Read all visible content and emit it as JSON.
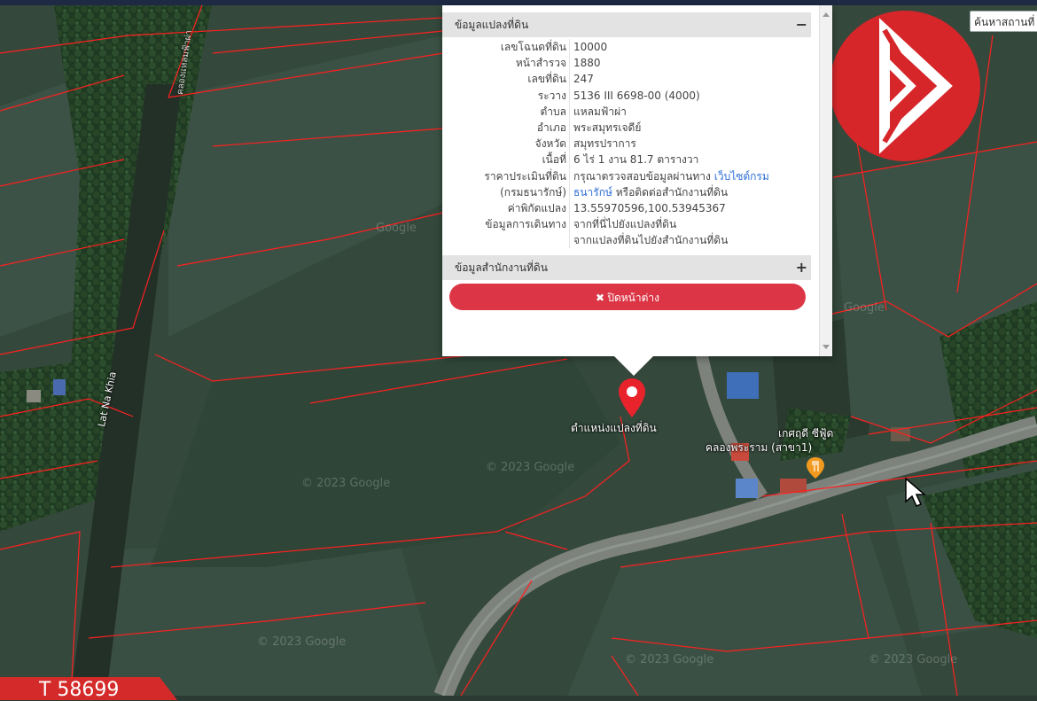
{
  "popup": {
    "section_title": "ข้อมูลแปลงที่ดิน",
    "section_toggle": "−",
    "rows": [
      {
        "key": "เลขโฉนดที่ดิน",
        "value": "10000"
      },
      {
        "key": "หน้าสำรวจ",
        "value": "1880"
      },
      {
        "key": "เลขที่ดิน",
        "value": "247"
      },
      {
        "key": "ระวาง",
        "value": "5136 III 6698-00 (4000)"
      },
      {
        "key": "ตำบล",
        "value": "แหลมฟ้าผ่า"
      },
      {
        "key": "อำเภอ",
        "value": "พระสมุทรเจดีย์"
      },
      {
        "key": "จังหวัด",
        "value": "สมุทรปราการ"
      },
      {
        "key": "เนื้อที่",
        "value": "6 ไร่ 1 งาน 81.7 ตารางวา"
      }
    ],
    "price_key_1": "ราคาประเมินที่ดิน",
    "price_key_2": "(กรมธนารักษ์)",
    "price_text_1": "กรุณาตรวจสอบข้อมูลผ่านทาง",
    "price_link_1": "เว็บไซต์กรม",
    "price_link_2": "ธนารักษ์",
    "price_text_2": "หรือติดต่อสำนักงานที่ดิน",
    "coord_key": "ค่าพิกัดแปลง",
    "coord_value": "13.55970596,100.53945367",
    "travel_key": "ข้อมูลการเดินทาง",
    "travel_link_1": "จากที่นี่ไปยังแปลงที่ดิน",
    "travel_link_2": "จากแปลงที่ดินไปยังสำนักงานที่ดิน",
    "office_title": "ข้อมูลสำนักงานที่ดิน",
    "office_toggle": "+",
    "close_label": "✖ ปิดหน้าต่าง"
  },
  "search": {
    "placeholder": "ค้นหาสถานที่"
  },
  "map": {
    "pin_label": "ตำแหน่งแปลงที่ดิน",
    "poi_line1": "เกศฤดี ซีฟู้ด",
    "poi_line2": "คลองพระราม (สาขา1)",
    "road_label_1": "Lat Na Khia",
    "road_label_2": "คลองแหลมฟ้าผ่า",
    "watermark": "© 2023 Google",
    "google": "Google",
    "pin_color": "#e8232b",
    "parcel_line_color": "#ff2020"
  },
  "badge": {
    "text": "T 58699",
    "color": "#d42a2a"
  },
  "logo": {
    "icon": "brand-logo-icon",
    "color": "#d6262a"
  }
}
